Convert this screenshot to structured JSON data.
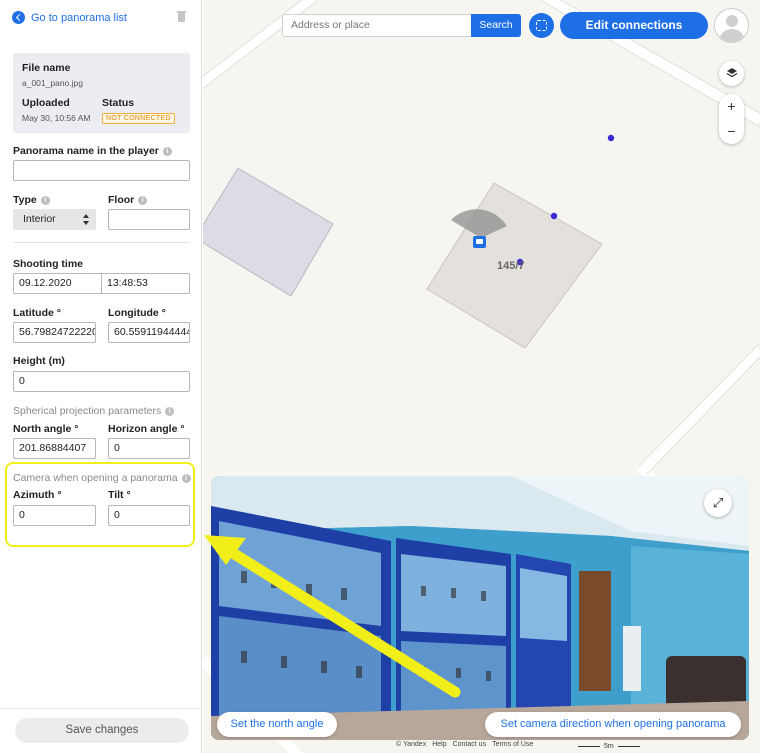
{
  "sidebar": {
    "back_label": "Go to panorama list",
    "file": {
      "name_label": "File name",
      "name_value": "a_001_pano.jpg",
      "uploaded_label": "Uploaded",
      "uploaded_value": "May 30, 10:56 AM",
      "status_label": "Status",
      "status_value": "NOT CONNECTED"
    },
    "panorama_name_label": "Panorama name in the player",
    "panorama_name_value": "",
    "type_label": "Type",
    "type_value": "Interior",
    "floor_label": "Floor",
    "floor_value": "",
    "shooting_time_label": "Shooting time",
    "shooting_date": "09.12.2020",
    "shooting_clock": "13:48:53",
    "latitude_label": "Latitude °",
    "latitude_value": "56.79824722220",
    "longitude_label": "Longitude °",
    "longitude_value": "60.55911944444",
    "height_label": "Height (m)",
    "height_value": "0",
    "spherical_label": "Spherical projection parameters",
    "north_angle_label": "North angle °",
    "north_angle_value": "201.86884407",
    "horizon_angle_label": "Horizon angle °",
    "horizon_angle_value": "0",
    "camera_label": "Camera when opening a panorama",
    "azimuth_label": "Azimuth °",
    "azimuth_value": "0",
    "tilt_label": "Tilt °",
    "tilt_value": "0",
    "save_label": "Save changes"
  },
  "map": {
    "search_placeholder": "Address or place",
    "search_button": "Search",
    "edit_connections": "Edit connections",
    "zoom_in": "+",
    "zoom_out": "−",
    "building_number": "145/7",
    "footer_links": [
      "© Yandex",
      "Help",
      "Contact us",
      "Terms of Use"
    ],
    "scale_label": "5m"
  },
  "panorama": {
    "set_north": "Set the north angle",
    "set_camera": "Set camera direction when opening panorama"
  },
  "colors": {
    "accent": "#1e6fe6",
    "highlight": "#f2ee1a",
    "status": "#e08a00"
  }
}
